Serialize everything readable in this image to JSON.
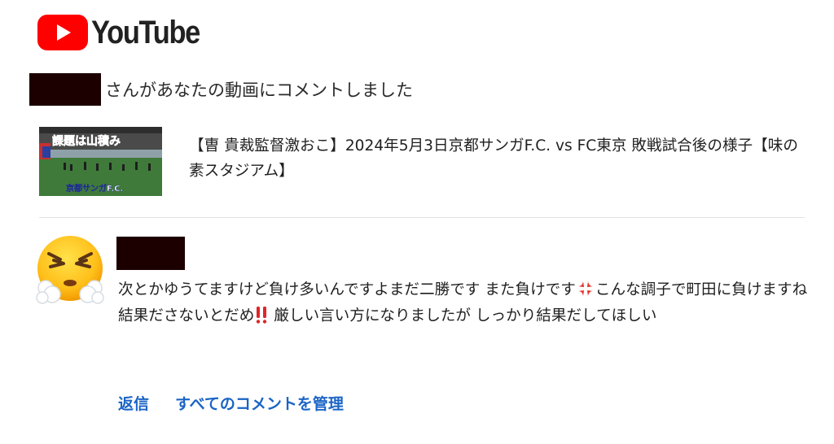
{
  "brand": {
    "logo_text": "YouTube",
    "logo_color": "#ff0000"
  },
  "notification": {
    "commenter_name": "[redacted]",
    "message": "さんがあなたの動画にコメントしました"
  },
  "video": {
    "thumbnail_text_top": "課題は山積み",
    "thumbnail_text_bottom": "京都サンガF.C.",
    "title": "【曺 貴裁監督激おこ】2024年5月3日京都サンガF.C. vs FC東京 敗戦試合後の様子【味の素スタジアム】"
  },
  "comment": {
    "avatar_icon": "face-with-steam-from-nose-emoji",
    "author": "[redacted]",
    "text_part1": "次とかゆうてますけど負け多いんですよまだ二勝です また負けです",
    "emoji_1": "anger-symbol-emoji",
    "text_part2": "こんな調子で町田に負けますね 結果ださないとだめ",
    "emoji_2": "double-exclamation-emoji",
    "text_part3": " 厳しい言い方になりましたが しっかり結果だしてほしい"
  },
  "actions": {
    "reply_label": "返信",
    "manage_label": "すべてのコメントを管理"
  },
  "colors": {
    "link": "#1a64c5",
    "divider": "#e2e2e2",
    "redaction": "#1c0000"
  }
}
